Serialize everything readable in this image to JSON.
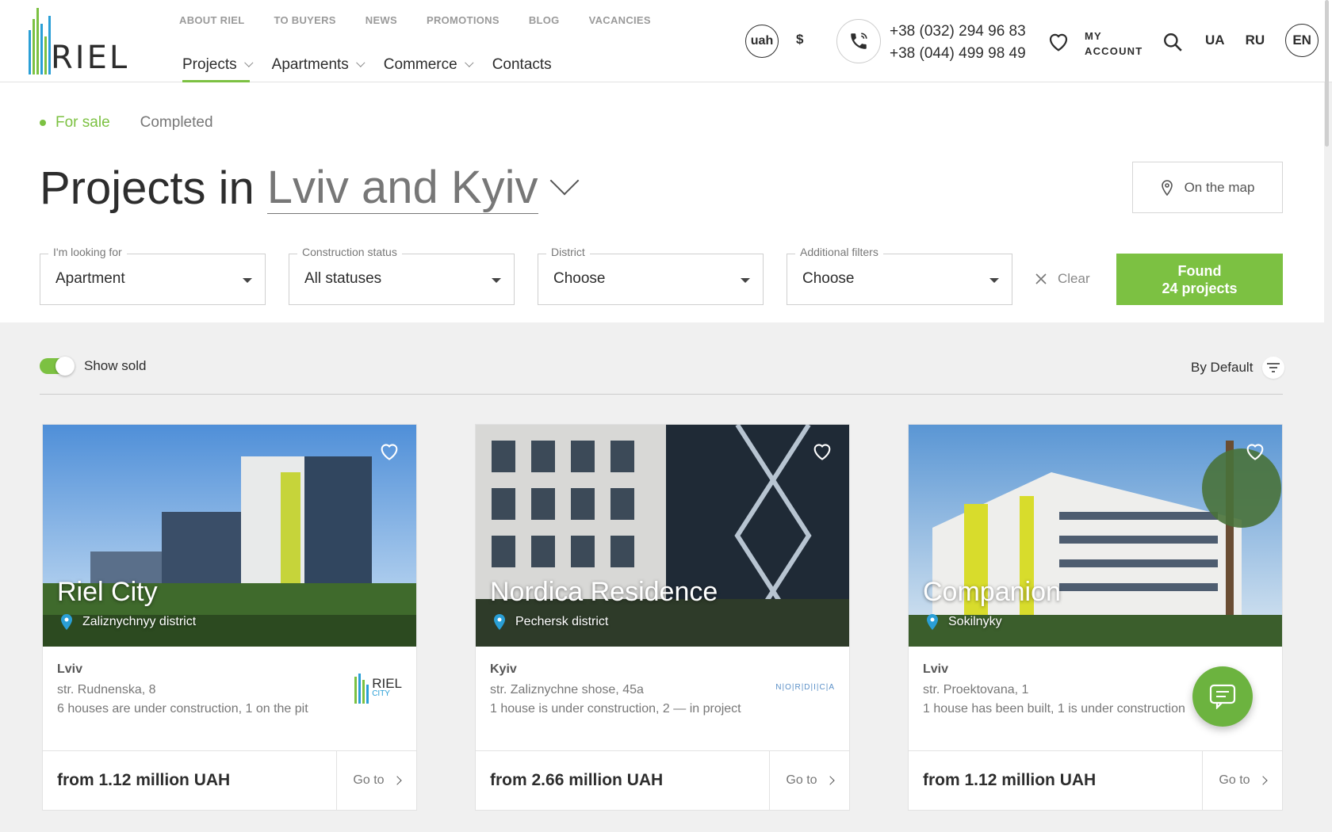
{
  "header": {
    "logo_text": "RIEL",
    "top_links": [
      "ABOUT RIEL",
      "TO BUYERS",
      "NEWS",
      "PROMOTIONS",
      "BLOG",
      "VACANCIES"
    ],
    "nav": [
      {
        "label": "Projects",
        "dropdown": true,
        "active": true
      },
      {
        "label": "Apartments",
        "dropdown": true
      },
      {
        "label": "Commerce",
        "dropdown": true
      },
      {
        "label": "Contacts",
        "dropdown": false
      }
    ],
    "currency_active": "uah",
    "currency_alt": "$",
    "phones": [
      "+38 (032) 294 96 83",
      "+38 (044) 499 98 49"
    ],
    "account_line1": "MY",
    "account_line2": "ACCOUNT",
    "languages": [
      "UA",
      "RU",
      "EN"
    ],
    "language_active": "EN"
  },
  "filters": {
    "status_tabs": [
      "For sale",
      "Completed"
    ],
    "title_prefix": "Projects in",
    "title_city": "Lviv and Kyiv",
    "map_button": "On the map",
    "fields": [
      {
        "label": "I'm looking for",
        "value": "Apartment"
      },
      {
        "label": "Construction status",
        "value": "All statuses"
      },
      {
        "label": "District",
        "value": "Choose"
      },
      {
        "label": "Additional filters",
        "value": "Choose"
      }
    ],
    "clear_label": "Clear",
    "found_line1": "Found",
    "found_line2": "24 projects"
  },
  "results": {
    "show_sold_label": "Show sold",
    "show_sold_on": true,
    "sort_label": "By Default"
  },
  "cards": [
    {
      "name": "Riel City",
      "district": "Zaliznychnyy district",
      "city": "Lviv",
      "address": "str. Rudnenska, 8",
      "houses": "6 houses are under construction, 1 on the pit",
      "price": "from 1.12 million UAH",
      "goto": "Go to",
      "brand": "RIEL",
      "brand_sub": "CITY"
    },
    {
      "name": "Nordica Residence",
      "district": "Pechersk district",
      "city": "Kyiv",
      "address": "str. Zaliznychne shose, 45a",
      "houses": "1 house is under construction, 2 — in project",
      "price": "from 2.66 million UAH",
      "goto": "Go to",
      "brand": "N|O|R|D|I|C|A"
    },
    {
      "name": "Companion",
      "district": "Sokilnyky",
      "city": "Lviv",
      "address": "str. Proektovana, 1",
      "houses": "1 house has been built, 1 is under construction",
      "price": "from 1.12 million UAH",
      "goto": "Go to"
    }
  ],
  "colors": {
    "accent": "#7cc142",
    "text": "#2d2d2d",
    "muted": "#777777",
    "background": "#f0f0f0"
  }
}
